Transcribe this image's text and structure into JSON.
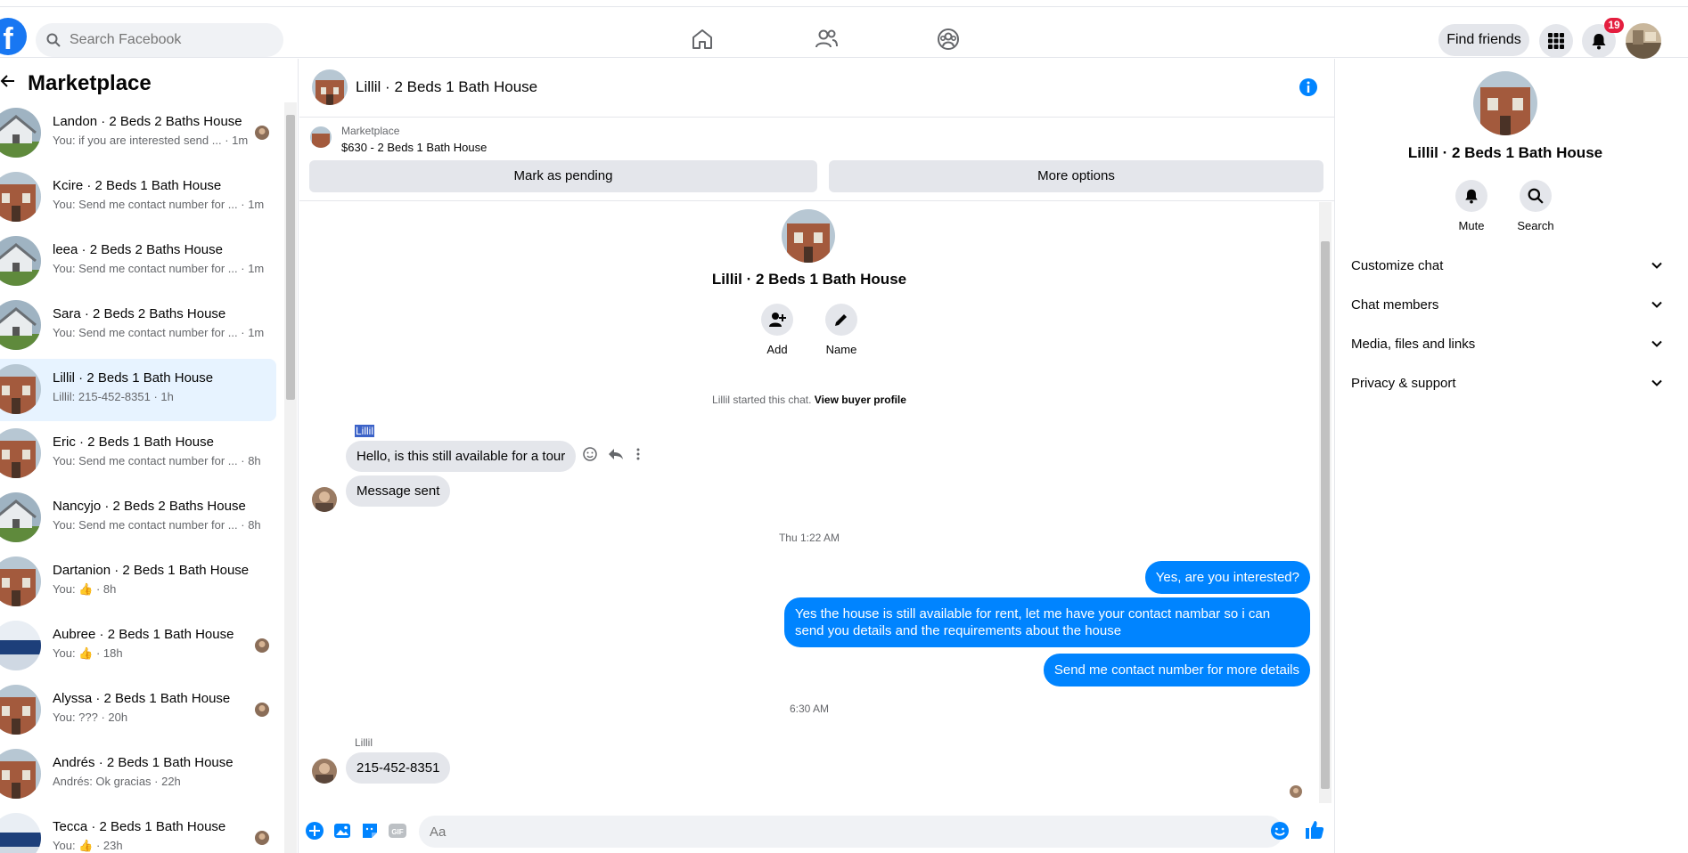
{
  "topbar": {
    "logo": "f",
    "search_placeholder": "Search Facebook",
    "find_friends": "Find friends",
    "notification_count": "19",
    "brand_color": "#1877f2"
  },
  "sidebar": {
    "title": "Marketplace",
    "conversations": [
      {
        "name": "Landon · 2 Beds 2 Baths House",
        "sub": "You: if you are interested send ... · 1m",
        "thumb": "white-house",
        "mini": "avatar"
      },
      {
        "name": "Kcire · 2 Beds 1 Bath House",
        "sub": "You: Send me contact number for ... · 1m",
        "thumb": "brick-house"
      },
      {
        "name": "leea · 2 Beds 2 Baths House",
        "sub": "You: Send me contact number for ... · 1m",
        "thumb": "white-house"
      },
      {
        "name": "Sara · 2 Beds 2 Baths House",
        "sub": "You: Send me contact number for ... · 1m",
        "thumb": "white-house"
      },
      {
        "name": "Lillil · 2 Beds 1 Bath House",
        "sub": "Lillil: 215-452-8351 · 1h",
        "thumb": "brick-house",
        "active": true
      },
      {
        "name": "Eric · 2 Beds 1 Bath House",
        "sub": "You: Send me contact number for ... · 8h",
        "thumb": "brick-house"
      },
      {
        "name": "Nancyjo · 2 Beds 2 Baths House",
        "sub": "You: Send me contact number for ... · 8h",
        "thumb": "white-house"
      },
      {
        "name": "Dartanion · 2 Beds 1 Bath House",
        "sub": "You: 👍 · 8h",
        "thumb": "brick-house"
      },
      {
        "name": "Aubree · 2 Beds 1 Bath House",
        "sub": "You: 👍 · 18h",
        "thumb": "blue-scene",
        "mini": "avatar"
      },
      {
        "name": "Alyssa · 2 Beds 1 Bath House",
        "sub": "You: ??? · 20h",
        "thumb": "brick-house",
        "mini": "avatar"
      },
      {
        "name": "Andrés · 2 Beds 1 Bath House",
        "sub": "Andrés: Ok gracias · 22h",
        "thumb": "brick-house"
      },
      {
        "name": "Tecca · 2 Beds 1 Bath House",
        "sub": "You: 👍 · 23h",
        "thumb": "blue-scene",
        "mini": "avatar"
      }
    ]
  },
  "chat": {
    "title": "Lillil · 2 Beds 1 Bath House",
    "marketplace_label": "Marketplace",
    "listing": "$630 - 2 Beds 1 Bath House",
    "mark_pending": "Mark as pending",
    "more_options": "More options",
    "profile_name": "Lillil · 2 Beds 1 Bath House",
    "add_label": "Add",
    "name_label": "Name",
    "started_text": "Lillil started this chat.",
    "view_profile": "View buyer profile",
    "sender": "Lillil",
    "msg1": "Hello, is this still available for a tour",
    "msg2": "Message sent",
    "ts1": "Thu 1:22 AM",
    "out1": "Yes, are you interested?",
    "out2": "Yes the house is still available for rent, let me have your contact nambar so i can send you details and the requirements about the house",
    "out3": "Send me contact number for more details",
    "ts2": "6:30 AM",
    "sender2": "Lillil",
    "msg3": "215-452-8351",
    "composer_placeholder": "Aa",
    "accent": "#0084ff"
  },
  "rpanel": {
    "name": "Lillil · 2 Beds 1 Bath House",
    "mute": "Mute",
    "search": "Search",
    "sections": [
      "Customize chat",
      "Chat members",
      "Media, files and links",
      "Privacy & support"
    ]
  }
}
